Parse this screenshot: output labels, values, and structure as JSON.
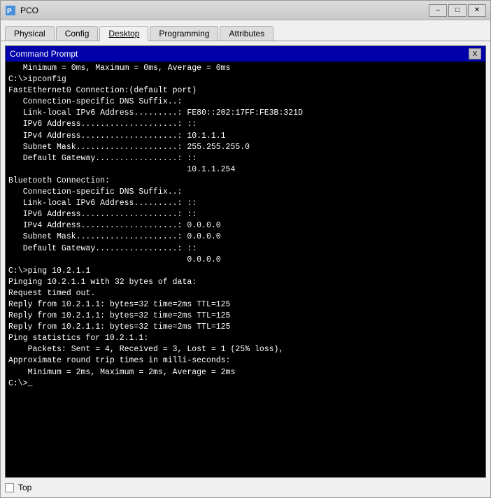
{
  "titleBar": {
    "icon": "pco-icon",
    "title": "PCO",
    "minimizeLabel": "–",
    "maximizeLabel": "□",
    "closeLabel": "✕"
  },
  "tabs": [
    {
      "id": "physical",
      "label": "Physical",
      "active": false
    },
    {
      "id": "config",
      "label": "Config",
      "active": false
    },
    {
      "id": "desktop",
      "label": "Desktop",
      "active": true
    },
    {
      "id": "programming",
      "label": "Programming",
      "active": false
    },
    {
      "id": "attributes",
      "label": "Attributes",
      "active": false
    }
  ],
  "cmdWindow": {
    "title": "Command Prompt",
    "closeLabel": "X"
  },
  "terminal": {
    "lines": [
      "   Minimum = 0ms, Maximum = 0ms, Average = 0ms",
      "",
      "C:\\>ipconfig",
      "",
      "FastEthernet0 Connection:(default port)",
      "",
      "   Connection-specific DNS Suffix..:",
      "   Link-local IPv6 Address.........: FE80::202:17FF:FE3B:321D",
      "   IPv6 Address....................: ::",
      "   IPv4 Address....................: 10.1.1.1",
      "   Subnet Mask.....................: 255.255.255.0",
      "   Default Gateway.................: ::",
      "                                     10.1.1.254",
      "",
      "Bluetooth Connection:",
      "",
      "   Connection-specific DNS Suffix..:",
      "   Link-local IPv6 Address.........: ::",
      "   IPv6 Address....................: ::",
      "   IPv4 Address....................: 0.0.0.0",
      "   Subnet Mask.....................: 0.0.0.0",
      "   Default Gateway.................: ::",
      "                                     0.0.0.0",
      "",
      "C:\\>ping 10.2.1.1",
      "",
      "Pinging 10.2.1.1 with 32 bytes of data:",
      "",
      "Request timed out.",
      "Reply from 10.2.1.1: bytes=32 time=2ms TTL=125",
      "Reply from 10.2.1.1: bytes=32 time=2ms TTL=125",
      "Reply from 10.2.1.1: bytes=32 time=2ms TTL=125",
      "",
      "Ping statistics for 10.2.1.1:",
      "    Packets: Sent = 4, Received = 3, Lost = 1 (25% loss),",
      "Approximate round trip times in milli-seconds:",
      "    Minimum = 2ms, Maximum = 2ms, Average = 2ms",
      "",
      "C:\\>_"
    ]
  },
  "bottomBar": {
    "checkboxLabel": "Top",
    "checked": false
  }
}
